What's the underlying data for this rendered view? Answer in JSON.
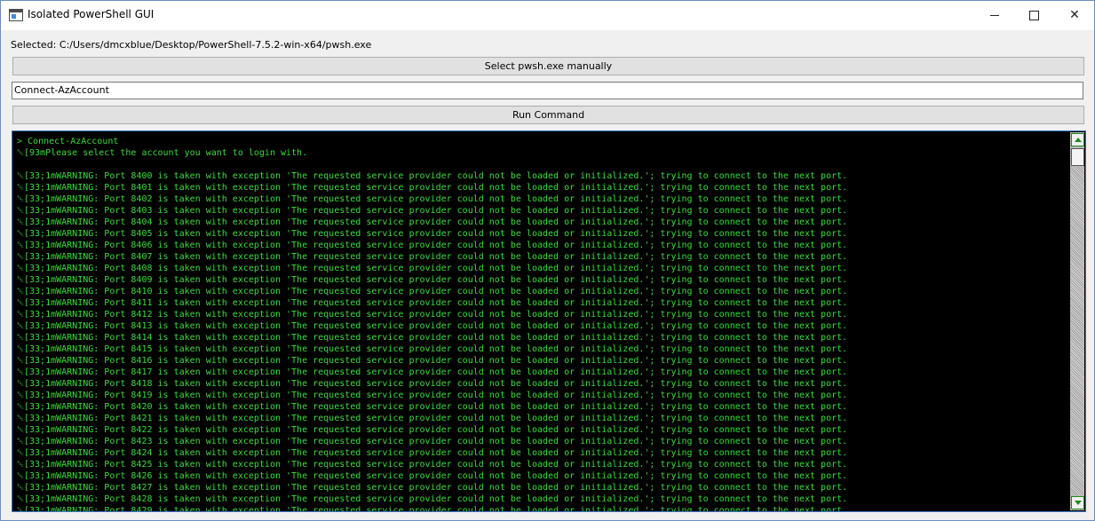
{
  "window": {
    "title": "Isolated PowerShell GUI",
    "controls": {
      "minimize": "—",
      "maximize": "☐",
      "close": "✕"
    }
  },
  "selected_path": "Selected: C:/Users/dmcxblue/Desktop/PowerShell-7.5.2-win-x64/pwsh.exe",
  "select_button_label": "Select pwsh.exe manually",
  "command_input_value": "Connect-AzAccount",
  "run_button_label": "Run Command",
  "console": {
    "text_color": "#3bdc3b",
    "background": "#000000",
    "lines": [
      "> Connect-AzAccount",
      "␛[93mPlease select the account you want to login with.",
      "",
      "␛[33;1mWARNING: Port 8400 is taken with exception 'The requested service provider could not be loaded or initialized.'; trying to connect to the next port.",
      "␛[33;1mWARNING: Port 8401 is taken with exception 'The requested service provider could not be loaded or initialized.'; trying to connect to the next port.",
      "␛[33;1mWARNING: Port 8402 is taken with exception 'The requested service provider could not be loaded or initialized.'; trying to connect to the next port.",
      "␛[33;1mWARNING: Port 8403 is taken with exception 'The requested service provider could not be loaded or initialized.'; trying to connect to the next port.",
      "␛[33;1mWARNING: Port 8404 is taken with exception 'The requested service provider could not be loaded or initialized.'; trying to connect to the next port.",
      "␛[33;1mWARNING: Port 8405 is taken with exception 'The requested service provider could not be loaded or initialized.'; trying to connect to the next port.",
      "␛[33;1mWARNING: Port 8406 is taken with exception 'The requested service provider could not be loaded or initialized.'; trying to connect to the next port.",
      "␛[33;1mWARNING: Port 8407 is taken with exception 'The requested service provider could not be loaded or initialized.'; trying to connect to the next port.",
      "␛[33;1mWARNING: Port 8408 is taken with exception 'The requested service provider could not be loaded or initialized.'; trying to connect to the next port.",
      "␛[33;1mWARNING: Port 8409 is taken with exception 'The requested service provider could not be loaded or initialized.'; trying to connect to the next port.",
      "␛[33;1mWARNING: Port 8410 is taken with exception 'The requested service provider could not be loaded or initialized.'; trying to connect to the next port.",
      "␛[33;1mWARNING: Port 8411 is taken with exception 'The requested service provider could not be loaded or initialized.'; trying to connect to the next port.",
      "␛[33;1mWARNING: Port 8412 is taken with exception 'The requested service provider could not be loaded or initialized.'; trying to connect to the next port.",
      "␛[33;1mWARNING: Port 8413 is taken with exception 'The requested service provider could not be loaded or initialized.'; trying to connect to the next port.",
      "␛[33;1mWARNING: Port 8414 is taken with exception 'The requested service provider could not be loaded or initialized.'; trying to connect to the next port.",
      "␛[33;1mWARNING: Port 8415 is taken with exception 'The requested service provider could not be loaded or initialized.'; trying to connect to the next port.",
      "␛[33;1mWARNING: Port 8416 is taken with exception 'The requested service provider could not be loaded or initialized.'; trying to connect to the next port.",
      "␛[33;1mWARNING: Port 8417 is taken with exception 'The requested service provider could not be loaded or initialized.'; trying to connect to the next port.",
      "␛[33;1mWARNING: Port 8418 is taken with exception 'The requested service provider could not be loaded or initialized.'; trying to connect to the next port.",
      "␛[33;1mWARNING: Port 8419 is taken with exception 'The requested service provider could not be loaded or initialized.'; trying to connect to the next port.",
      "␛[33;1mWARNING: Port 8420 is taken with exception 'The requested service provider could not be loaded or initialized.'; trying to connect to the next port.",
      "␛[33;1mWARNING: Port 8421 is taken with exception 'The requested service provider could not be loaded or initialized.'; trying to connect to the next port.",
      "␛[33;1mWARNING: Port 8422 is taken with exception 'The requested service provider could not be loaded or initialized.'; trying to connect to the next port.",
      "␛[33;1mWARNING: Port 8423 is taken with exception 'The requested service provider could not be loaded or initialized.'; trying to connect to the next port.",
      "␛[33;1mWARNING: Port 8424 is taken with exception 'The requested service provider could not be loaded or initialized.'; trying to connect to the next port.",
      "␛[33;1mWARNING: Port 8425 is taken with exception 'The requested service provider could not be loaded or initialized.'; trying to connect to the next port.",
      "␛[33;1mWARNING: Port 8426 is taken with exception 'The requested service provider could not be loaded or initialized.'; trying to connect to the next port.",
      "␛[33;1mWARNING: Port 8427 is taken with exception 'The requested service provider could not be loaded or initialized.'; trying to connect to the next port.",
      "␛[33;1mWARNING: Port 8428 is taken with exception 'The requested service provider could not be loaded or initialized.'; trying to connect to the next port.",
      "␛[33;1mWARNING: Port 8429 is taken with exception 'The requested service provider could not be loaded or initialized.'; trying to connect to the next port."
    ]
  }
}
